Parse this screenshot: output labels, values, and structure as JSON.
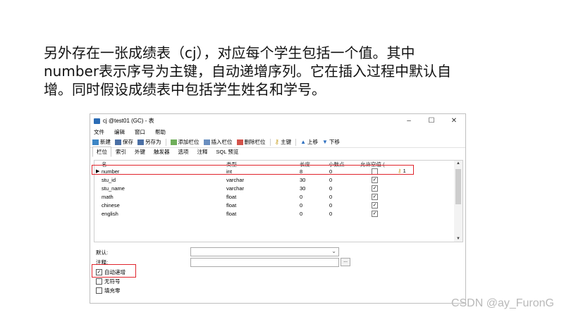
{
  "paragraph": {
    "line1": "另外存在一张成绩表（cj），对应每个学生包括一个值。其中",
    "line2": "number表示序号为主键，自动递增序列。它在插入过程中默认自",
    "line3": "增。同时假设成绩表中包括学生姓名和学号。"
  },
  "window": {
    "title": "cj @test01 (GC) - 表",
    "controls": {
      "minimize": "–",
      "maximize": "☐",
      "close": "✕"
    },
    "menu": [
      "文件",
      "编辑",
      "窗口",
      "帮助"
    ],
    "toolbar": [
      "新建",
      "保存",
      "另存为",
      "添加栏位",
      "插入栏位",
      "删除栏位",
      "主键",
      "上移",
      "下移"
    ],
    "tabs": [
      "栏位",
      "索引",
      "外键",
      "触发器",
      "选项",
      "注释",
      "SQL 预览"
    ],
    "grid": {
      "headers": [
        "名",
        "类型",
        "长度",
        "小数点",
        "允许空值 ("
      ],
      "rows": [
        {
          "name": "number",
          "type": "int",
          "length": "8",
          "decimals": "0",
          "nullable": false,
          "key": "1",
          "selected": true
        },
        {
          "name": "stu_id",
          "type": "varchar",
          "length": "30",
          "decimals": "0",
          "nullable": true
        },
        {
          "name": "stu_name",
          "type": "varchar",
          "length": "30",
          "decimals": "0",
          "nullable": true
        },
        {
          "name": "math",
          "type": "float",
          "length": "0",
          "decimals": "0",
          "nullable": true
        },
        {
          "name": "chinese",
          "type": "float",
          "length": "0",
          "decimals": "0",
          "nullable": true
        },
        {
          "name": "english",
          "type": "float",
          "length": "0",
          "decimals": "0",
          "nullable": true
        }
      ]
    },
    "form": {
      "default_label": "默认:",
      "comment_label": "注释:",
      "ellipsis": "...",
      "options": [
        {
          "label": "自动递增",
          "checked": true
        },
        {
          "label": "无符号",
          "checked": false
        },
        {
          "label": "填充零",
          "checked": false
        }
      ]
    }
  },
  "watermark": "CSDN @ay_FuronG",
  "colors": {
    "highlight": "#e0242c"
  }
}
